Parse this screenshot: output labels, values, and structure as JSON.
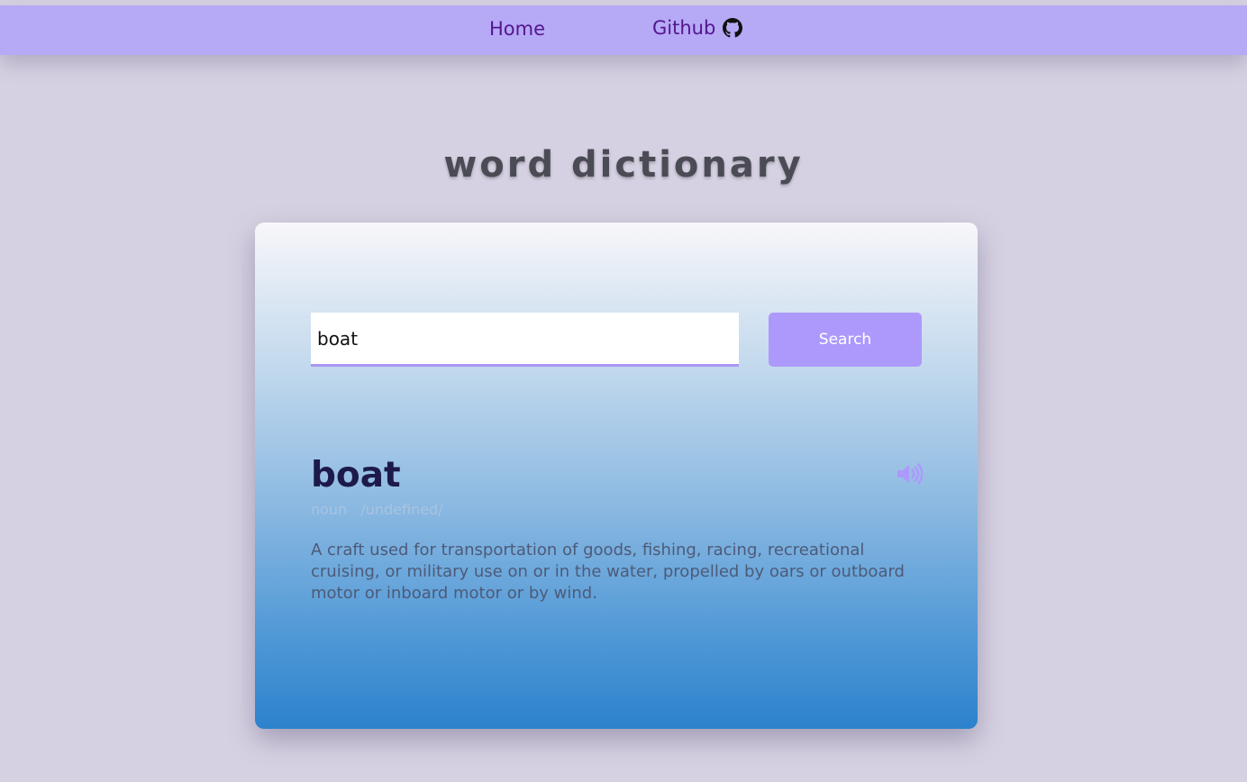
{
  "nav": {
    "home_label": "Home",
    "github_label": "Github",
    "github_icon": "github-icon",
    "background": "#b6a9f6",
    "link_color": "#55168d"
  },
  "page": {
    "title": "word dictionary",
    "background": "#d6d1e2"
  },
  "search": {
    "value": "boat",
    "placeholder": "",
    "button_label": "Search",
    "accent": "#ad99fb"
  },
  "result": {
    "word": "boat",
    "part_of_speech": "noun",
    "phonetic": "/undefined/",
    "audio_icon": "speaker-icon",
    "definition": "A craft used for transportation of goods, fishing, racing, recreational cruising, or military use on or in the water, propelled by oars or outboard motor or inboard motor or by wind."
  }
}
